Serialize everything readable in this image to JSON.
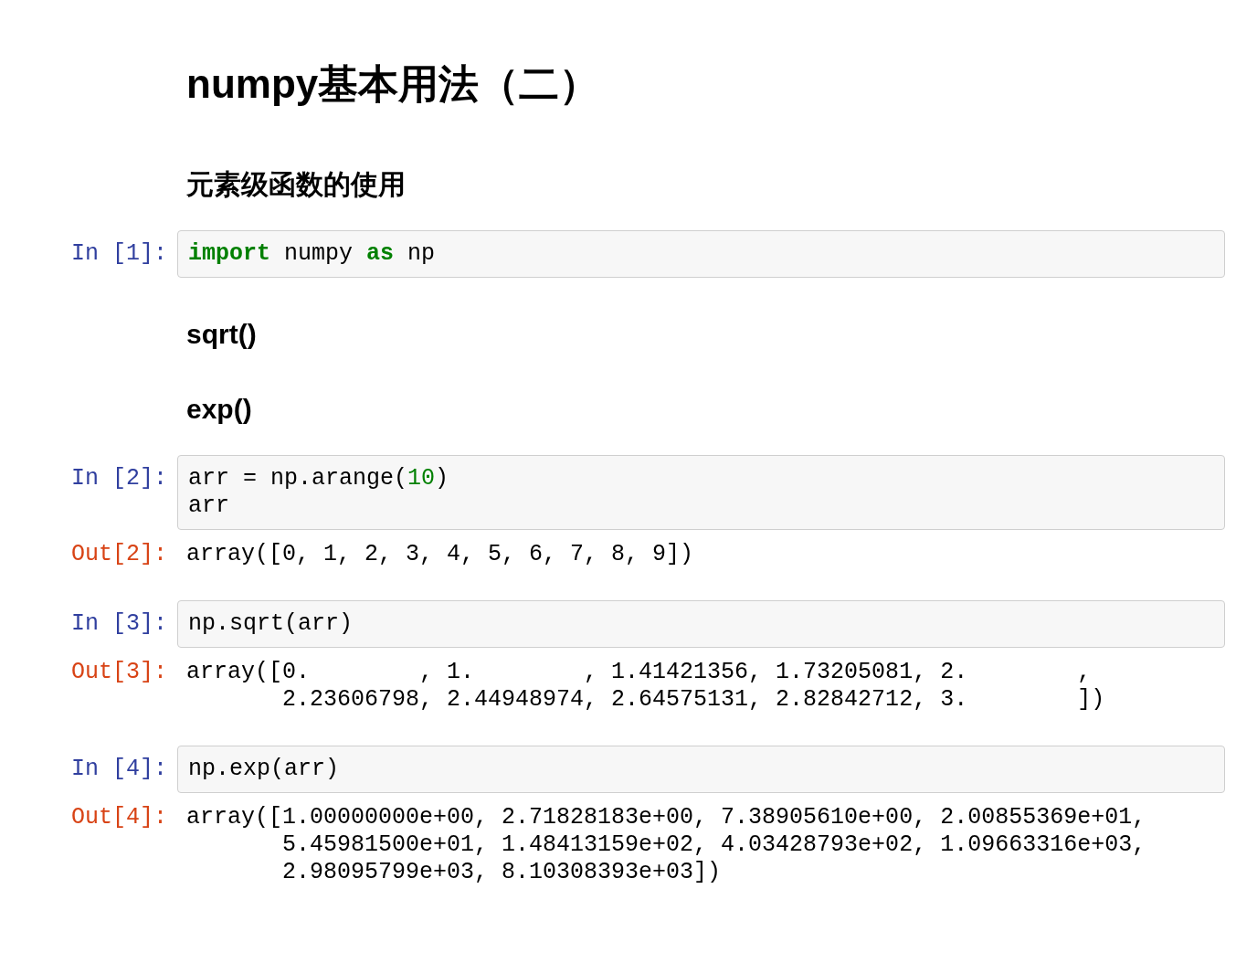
{
  "cells": [
    {
      "kind": "title",
      "text": "numpy基本用法（二）"
    },
    {
      "kind": "section",
      "text": "元素级函数的使用"
    },
    {
      "kind": "code",
      "prompt": "In [1]:",
      "lines": [
        [
          {
            "kind": "keyword",
            "text": "import"
          },
          {
            "kind": "plain",
            "text": " numpy "
          },
          {
            "kind": "keyword",
            "text": "as"
          },
          {
            "kind": "plain",
            "text": " np"
          }
        ]
      ]
    },
    {
      "kind": "subsection",
      "text": "sqrt()"
    },
    {
      "kind": "subsection",
      "text": "exp()"
    },
    {
      "kind": "code",
      "prompt": "In [2]:",
      "lines": [
        [
          {
            "kind": "plain",
            "text": "arr = np.arange("
          },
          {
            "kind": "number",
            "text": "10"
          },
          {
            "kind": "plain",
            "text": ")"
          }
        ],
        [
          {
            "kind": "plain",
            "text": "arr"
          }
        ]
      ],
      "output": {
        "prompt": "Out[2]:",
        "lines": [
          "array([0, 1, 2, 3, 4, 5, 6, 7, 8, 9])"
        ]
      }
    },
    {
      "kind": "code",
      "prompt": "In [3]:",
      "lines": [
        [
          {
            "kind": "plain",
            "text": "np.sqrt(arr)"
          }
        ]
      ],
      "output": {
        "prompt": "Out[3]:",
        "lines": [
          "array([0.        , 1.        , 1.41421356, 1.73205081, 2.        ,",
          "       2.23606798, 2.44948974, 2.64575131, 2.82842712, 3.        ])"
        ]
      }
    },
    {
      "kind": "code",
      "prompt": "In [4]:",
      "lines": [
        [
          {
            "kind": "plain",
            "text": "np.exp(arr)"
          }
        ]
      ],
      "output": {
        "prompt": "Out[4]:",
        "lines": [
          "array([1.00000000e+00, 2.71828183e+00, 7.38905610e+00, 2.00855369e+01,",
          "       5.45981500e+01, 1.48413159e+02, 4.03428793e+02, 1.09663316e+03,",
          "       2.98095799e+03, 8.10308393e+03])"
        ]
      }
    }
  ]
}
